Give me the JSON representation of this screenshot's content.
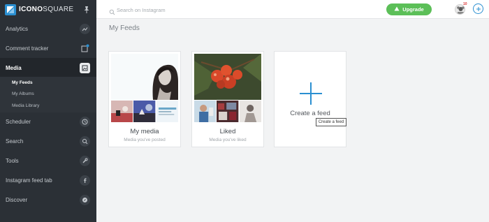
{
  "brand": {
    "logo_bold": "ICONO",
    "logo_light": "SQUARE"
  },
  "sidebar": {
    "items": [
      {
        "label": "Analytics",
        "icon": "trend-icon"
      },
      {
        "label": "Comment tracker",
        "icon": "comment-icon"
      },
      {
        "label": "Media",
        "icon": "media-icon",
        "active": true
      },
      {
        "label": "Scheduler",
        "icon": "clock-icon"
      },
      {
        "label": "Search",
        "icon": "search-icon"
      },
      {
        "label": "Tools",
        "icon": "wrench-icon"
      },
      {
        "label": "Instagram feed tab",
        "icon": "facebook-icon"
      },
      {
        "label": "Discover",
        "icon": "compass-icon"
      }
    ],
    "media_sub": [
      "My Feeds",
      "My Albums",
      "Media Library"
    ]
  },
  "topbar": {
    "search_placeholder": "Search on Instagram",
    "upgrade_label": "Upgrade",
    "notifications_count": "10"
  },
  "page": {
    "title": "My Feeds"
  },
  "cards": [
    {
      "title": "My media",
      "subtitle": "Media you've posted"
    },
    {
      "title": "Liked",
      "subtitle": "Media you've liked"
    },
    {
      "title": "Create a feed"
    }
  ],
  "tooltip": "Create a feed",
  "colors": {
    "accent": "#2a8fd1",
    "upgrade": "#5cbf58",
    "sidebar": "#2b3036"
  }
}
